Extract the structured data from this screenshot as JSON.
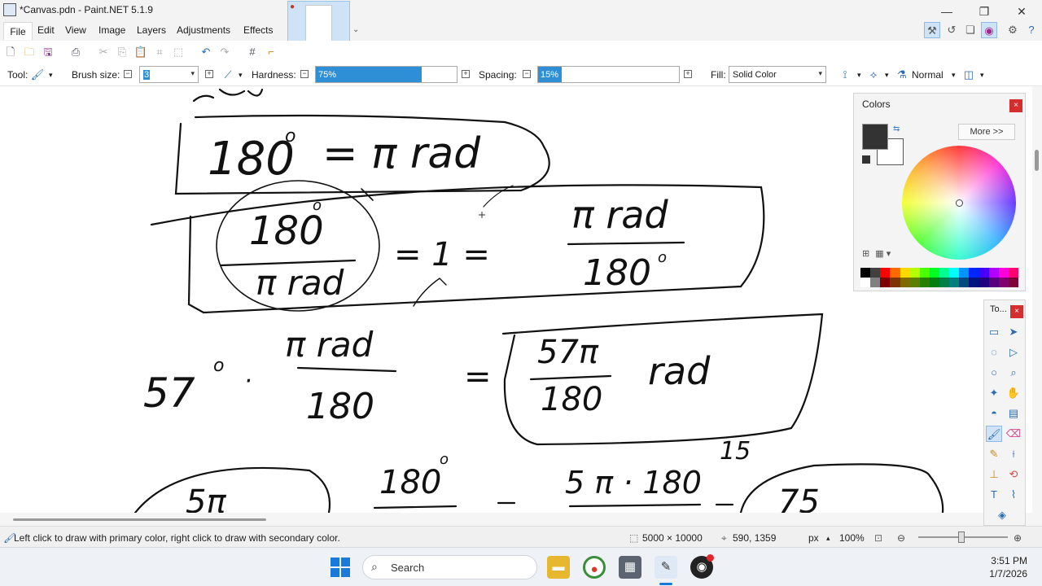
{
  "window": {
    "title": "*Canvas.pdn - Paint.NET 5.1.9",
    "minimize_glyph": "—",
    "restore_glyph": "❐",
    "close_glyph": "✕"
  },
  "menu": {
    "items": [
      "File",
      "Edit",
      "View",
      "Image",
      "Layers",
      "Adjustments",
      "Effects"
    ]
  },
  "thumbnail": {
    "close_glyph": "●",
    "dropdown_glyph": "⌄"
  },
  "toolbar": {
    "icons": [
      "new-icon",
      "open-icon",
      "save-icon",
      "print-icon",
      "cut-icon",
      "copy-icon",
      "paste-icon",
      "crop-icon",
      "deselect-icon",
      "undo-icon",
      "redo-icon",
      "grid-icon",
      "ruler-icon"
    ]
  },
  "options": {
    "tool_label": "Tool:",
    "brush_size_label": "Brush size:",
    "brush_size_value": "3",
    "hardness_label": "Hardness:",
    "hardness_value": "75%",
    "hardness_fraction": 0.75,
    "spacing_label": "Spacing:",
    "spacing_value": "15%",
    "spacing_fraction": 0.15,
    "fill_label": "Fill:",
    "fill_value": "Solid Color",
    "blend_mode": "Normal",
    "minus_glyph": "−",
    "plus_glyph": "+"
  },
  "colors_panel": {
    "title": "Colors",
    "more_button": "More >>",
    "close_glyph": "×",
    "primary_color": "#333333",
    "secondary_color": "#ffffff",
    "palette_top": [
      "#000000",
      "#404040",
      "#ff0000",
      "#ff6a00",
      "#ffd800",
      "#b6ff00",
      "#4cff00",
      "#00ff21",
      "#00ff90",
      "#00ffff",
      "#0094ff",
      "#0026ff",
      "#4800ff",
      "#b200ff",
      "#ff00dc",
      "#ff006e"
    ],
    "palette_bottom": [
      "#ffffff",
      "#808080",
      "#7f0000",
      "#7f3300",
      "#7f6a00",
      "#5b7f00",
      "#267f00",
      "#007f0e",
      "#007f46",
      "#007f7f",
      "#004a7f",
      "#00137f",
      "#21007f",
      "#57007f",
      "#7f006e",
      "#7f0037"
    ]
  },
  "tools_panel": {
    "title": "To...",
    "close_glyph": "×"
  },
  "status": {
    "hint": "Left click to draw with primary color, right click to draw with secondary color.",
    "image_size": "5000 × 10000",
    "cursor_pos": "590, 1359",
    "units": "px",
    "zoom": "100%"
  },
  "taskbar": {
    "search_placeholder": "Search",
    "time": "3:51 PM",
    "date": "1/7/2026"
  },
  "canvas_text": {
    "row1_a": "180",
    "row1_b": "= π rad",
    "row2_num": "180",
    "row2_den": "π rad",
    "row2_mid": "=  1  =",
    "row2_rnum": "π rad",
    "row2_rden": "180",
    "row3_a": "57",
    "row3_num": "π rad",
    "row3_den": "180",
    "row3_eq": "=",
    "row3_rnum": "57π",
    "row3_rden": "180",
    "row3_unit": "rad",
    "row4_a": "5π",
    "row4_b": "180",
    "row4_c": "5 π · 180",
    "row4_d": "15",
    "row4_e": "75"
  }
}
